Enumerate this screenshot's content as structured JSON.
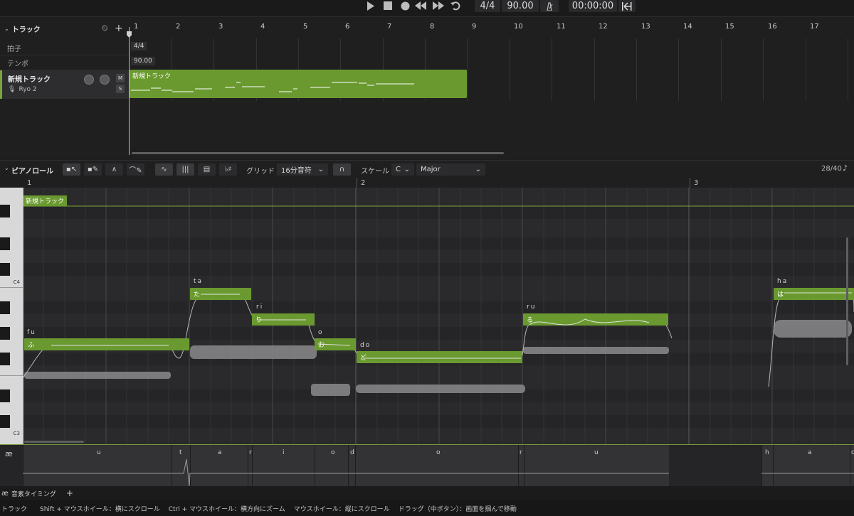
{
  "transport": {
    "time_signature": "4/4",
    "tempo": "90.00",
    "time": "00:00:00"
  },
  "tracks_panel": {
    "title": "トラック",
    "rows": {
      "beat_label": "拍子",
      "beat_value": "4/4",
      "tempo_label": "テンポ",
      "tempo_value": "90.00"
    },
    "track": {
      "name": "新規トラック",
      "singer": "Ryo 2",
      "mute": "M",
      "solo": "S",
      "clip_name": "新規トラック"
    },
    "ruler": [
      "1",
      "2",
      "3",
      "4",
      "5",
      "6",
      "7",
      "8",
      "9",
      "10",
      "11",
      "12",
      "13",
      "14",
      "15",
      "16",
      "17"
    ]
  },
  "piano_roll": {
    "title": "ピアノロール",
    "grid_label": "グリッド",
    "grid_value": "16分音符",
    "scale_label": "スケール",
    "scale_key": "C",
    "scale_mode": "Major",
    "page_counter": "28/40",
    "ruler": [
      "1",
      "2",
      "3"
    ],
    "clip_label": "新規トラック",
    "key_labels": [
      "C4",
      "C3"
    ],
    "notes": [
      {
        "lyric": "ふ",
        "romaji": "fu"
      },
      {
        "lyric": "た",
        "romaji": "ta"
      },
      {
        "lyric": "り",
        "romaji": "ri"
      },
      {
        "lyric": "お",
        "romaji": "o"
      },
      {
        "lyric": "ど",
        "romaji": "do"
      },
      {
        "lyric": "る",
        "romaji": "ru"
      },
      {
        "lyric": "は",
        "romaji": "ha"
      }
    ]
  },
  "phonemes": {
    "lane_icon": "æ",
    "items": [
      "u",
      "t",
      "a",
      "r",
      "i",
      "o",
      "d",
      "o",
      "r",
      "u",
      "h",
      "a",
      "o"
    ]
  },
  "phoneme_tab": {
    "icon": "æ",
    "label": "音素タイミング",
    "add": "+"
  },
  "status_bar": {
    "context": "トラック",
    "hints": [
      "Shift + マウスホイール：横にスクロール",
      "Ctrl + マウスホイール：横方向にズーム",
      "マウスホイール：縦にスクロール",
      "ドラッグ（中ボタン）：画面を掴んで移動"
    ]
  }
}
